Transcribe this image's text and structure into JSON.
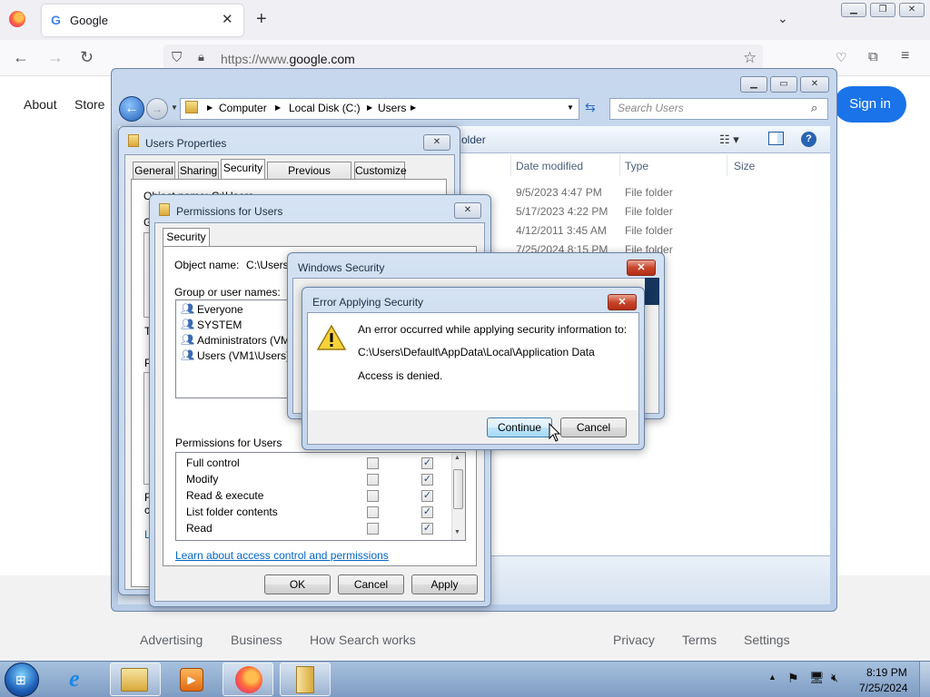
{
  "browser": {
    "tab_title": "Google",
    "url_prefix": "https://www.",
    "url_domain": "google.com"
  },
  "google": {
    "nav_links": [
      "About",
      "Store"
    ],
    "sign_in": "Sign in",
    "footer_left": [
      "Advertising",
      "Business",
      "How Search works"
    ],
    "footer_right": [
      "Privacy",
      "Terms",
      "Settings"
    ]
  },
  "explorer": {
    "breadcrumb": [
      "Computer",
      "Local Disk (C:)",
      "Users"
    ],
    "search_placeholder": "Search Users",
    "toolbar_fragment": "older",
    "columns": [
      "Date modified",
      "Type",
      "Size"
    ],
    "rows": [
      {
        "date": "9/5/2023 4:47 PM",
        "type": "File folder"
      },
      {
        "date": "5/17/2023 4:22 PM",
        "type": "File folder"
      },
      {
        "date": "4/12/2011 3:45 AM",
        "type": "File folder"
      },
      {
        "date": "7/25/2024 8:15 PM",
        "type": "File folder"
      },
      {
        "date": "",
        "type": "File folder"
      },
      {
        "date": "",
        "type": "File folder"
      }
    ]
  },
  "users_properties": {
    "title": "Users Properties",
    "tabs": [
      "General",
      "Sharing",
      "Security",
      "Previous Versions",
      "Customize"
    ],
    "obj_fragment": "Object name:   C:\\Users",
    "left_frags": [
      "G",
      "T",
      "P",
      "F",
      "c",
      "L"
    ]
  },
  "permissions": {
    "title": "Permissions for Users",
    "tab": "Security",
    "object_label": "Object name:",
    "object_value": "C:\\Users",
    "group_label": "Group or user names:",
    "users": [
      "Everyone",
      "SYSTEM",
      "Administrators (VM1\\",
      "Users (VM1\\Users)"
    ],
    "perm_label": "Permissions for Users",
    "perms": [
      {
        "name": "Full control",
        "allow": false,
        "deny": true
      },
      {
        "name": "Modify",
        "allow": false,
        "deny": true
      },
      {
        "name": "Read & execute",
        "allow": false,
        "deny": true
      },
      {
        "name": "List folder contents",
        "allow": false,
        "deny": true
      },
      {
        "name": "Read",
        "allow": false,
        "deny": true
      }
    ],
    "link": "Learn about access control and permissions",
    "ok": "OK",
    "cancel": "Cancel",
    "apply": "Apply"
  },
  "windows_security": {
    "title": "Windows Security"
  },
  "error_dialog": {
    "title": "Error Applying Security",
    "line1": "An error occurred while applying security information to:",
    "line2": "C:\\Users\\Default\\AppData\\Local\\Application Data",
    "line3": "Access is denied.",
    "continue": "Continue",
    "cancel": "Cancel"
  },
  "taskbar": {
    "time": "8:19 PM",
    "date": "7/25/2024"
  },
  "colors": {
    "google_blue": "#1a73e8",
    "aero_close_red": "#c8452b",
    "link_blue": "#0066cc"
  }
}
